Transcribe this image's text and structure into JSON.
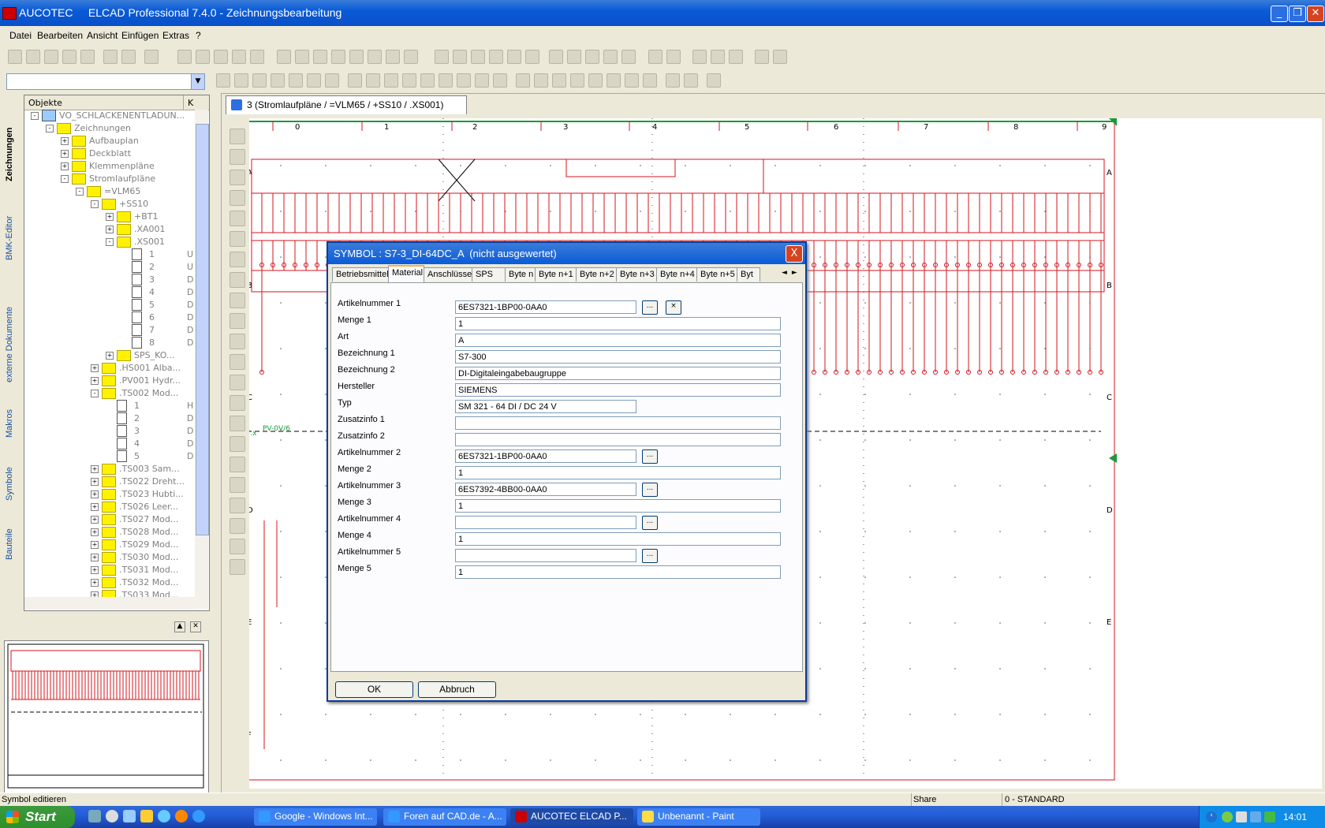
{
  "window": {
    "title": "AUCOTEC     ELCAD Professional 7.4.0 - Zeichnungsbearbeitung"
  },
  "menu": [
    "Datei",
    "Bearbeiten",
    "Ansicht",
    "Einfügen",
    "Extras",
    "?"
  ],
  "side_tabs": [
    "Zeichnungen",
    "BMK-Editor",
    "externe Dokumente",
    "Makros",
    "Symbole",
    "Bauteile"
  ],
  "object_panel": {
    "header_objects": "Objekte",
    "header_col2": "K",
    "tree": [
      {
        "label": "VO_SCHLACKENENTLADUN...",
        "level": 0,
        "expander": "-",
        "icon": "computer",
        "rv": ""
      },
      {
        "label": "Zeichnungen",
        "level": 1,
        "expander": "-",
        "icon": "folder",
        "rv": ""
      },
      {
        "label": "Aufbauplan",
        "level": 2,
        "expander": "+",
        "icon": "folder",
        "rv": ""
      },
      {
        "label": "Deckblatt",
        "level": 2,
        "expander": "+",
        "icon": "folder",
        "rv": ""
      },
      {
        "label": "Klemmenpläne",
        "level": 2,
        "expander": "+",
        "icon": "folder",
        "rv": ""
      },
      {
        "label": "Stromlaufpläne",
        "level": 2,
        "expander": "-",
        "icon": "folder",
        "rv": ""
      },
      {
        "label": "=VLM65",
        "level": 3,
        "expander": "-",
        "icon": "folder",
        "rv": ""
      },
      {
        "label": "+SS10",
        "level": 4,
        "expander": "-",
        "icon": "folder",
        "rv": ""
      },
      {
        "label": "+BT1",
        "level": 5,
        "expander": "+",
        "icon": "folder",
        "rv": ""
      },
      {
        "label": ".XA001",
        "level": 5,
        "expander": "+",
        "icon": "folder",
        "rv": ""
      },
      {
        "label": ".XS001",
        "level": 5,
        "expander": "-",
        "icon": "folder",
        "rv": ""
      },
      {
        "label": "1",
        "level": 6,
        "expander": "",
        "icon": "doc",
        "rv": "U"
      },
      {
        "label": "2",
        "level": 6,
        "expander": "",
        "icon": "doc",
        "rv": "U"
      },
      {
        "label": "3",
        "level": 6,
        "expander": "",
        "icon": "doc",
        "rv": "D"
      },
      {
        "label": "4",
        "level": 6,
        "expander": "",
        "icon": "doc",
        "rv": "D"
      },
      {
        "label": "5",
        "level": 6,
        "expander": "",
        "icon": "doc",
        "rv": "D"
      },
      {
        "label": "6",
        "level": 6,
        "expander": "",
        "icon": "doc",
        "rv": "D"
      },
      {
        "label": "7",
        "level": 6,
        "expander": "",
        "icon": "doc",
        "rv": "D"
      },
      {
        "label": "8",
        "level": 6,
        "expander": "",
        "icon": "doc",
        "rv": "D"
      },
      {
        "label": "SPS_KO...",
        "level": 5,
        "expander": "+",
        "icon": "folder",
        "rv": ""
      },
      {
        "label": ".HS001 Alba...",
        "level": 4,
        "expander": "+",
        "icon": "folder",
        "rv": ""
      },
      {
        "label": ".PV001 Hydr...",
        "level": 4,
        "expander": "+",
        "icon": "folder",
        "rv": ""
      },
      {
        "label": ".TS002 Mod...",
        "level": 4,
        "expander": "-",
        "icon": "folder",
        "rv": ""
      },
      {
        "label": "1",
        "level": 5,
        "expander": "",
        "icon": "doc",
        "rv": "H"
      },
      {
        "label": "2",
        "level": 5,
        "expander": "",
        "icon": "doc",
        "rv": "D"
      },
      {
        "label": "3",
        "level": 5,
        "expander": "",
        "icon": "doc",
        "rv": "D"
      },
      {
        "label": "4",
        "level": 5,
        "expander": "",
        "icon": "doc",
        "rv": "D"
      },
      {
        "label": "5",
        "level": 5,
        "expander": "",
        "icon": "doc",
        "rv": "D"
      },
      {
        "label": ".TS003 Sam...",
        "level": 4,
        "expander": "+",
        "icon": "folder",
        "rv": ""
      },
      {
        "label": ".TS022 Dreht...",
        "level": 4,
        "expander": "+",
        "icon": "folder",
        "rv": ""
      },
      {
        "label": ".TS023 Hubti...",
        "level": 4,
        "expander": "+",
        "icon": "folder",
        "rv": ""
      },
      {
        "label": ".TS026 Leer...",
        "level": 4,
        "expander": "+",
        "icon": "folder",
        "rv": ""
      },
      {
        "label": ".TS027 Mod...",
        "level": 4,
        "expander": "+",
        "icon": "folder",
        "rv": ""
      },
      {
        "label": ".TS028 Mod...",
        "level": 4,
        "expander": "+",
        "icon": "folder",
        "rv": ""
      },
      {
        "label": ".TS029 Mod...",
        "level": 4,
        "expander": "+",
        "icon": "folder",
        "rv": ""
      },
      {
        "label": ".TS030 Mod...",
        "level": 4,
        "expander": "+",
        "icon": "folder",
        "rv": ""
      },
      {
        "label": ".TS031 Mod...",
        "level": 4,
        "expander": "+",
        "icon": "folder",
        "rv": ""
      },
      {
        "label": ".TS032 Mod...",
        "level": 4,
        "expander": "+",
        "icon": "folder",
        "rv": ""
      },
      {
        "label": ".TS033 Mod...",
        "level": 4,
        "expander": "+",
        "icon": "folder",
        "rv": ""
      }
    ]
  },
  "document": {
    "tab_label": "3 (Stromlaufpläne / =VLM65 / +SS10 / .XS001)",
    "columns": [
      "0",
      "1",
      "2",
      "3",
      "4",
      "5",
      "6",
      "7",
      "8",
      "9"
    ],
    "rows": [
      "A",
      "B",
      "C",
      "D",
      "E",
      "F"
    ],
    "annotation_left": "S1/7.x",
    "annotation_pv": "PV-0V/6"
  },
  "dialog": {
    "title": "SYMBOL : S7-3_DI-64DC_A  (nicht ausgewertet)",
    "close": "X",
    "tabs": [
      "Betriebsmittel",
      "Material",
      "Anschlüsse",
      "SPS",
      "Byte n",
      "Byte n+1",
      "Byte n+2",
      "Byte n+3",
      "Byte n+4",
      "Byte n+5",
      "Byt"
    ],
    "active_tab": "Material",
    "fields": [
      {
        "label": "Artikelnummer 1",
        "value": "6ES7321-1BP00-0AA0",
        "browse": true,
        "clear": true
      },
      {
        "label": "Menge 1",
        "value": "1"
      },
      {
        "label": "Art",
        "value": "A"
      },
      {
        "label": "Bezeichnung 1",
        "value": "S7-300"
      },
      {
        "label": "Bezeichnung 2",
        "value": "DI-Digitaleingabebaugruppe"
      },
      {
        "label": "Hersteller",
        "value": "SIEMENS"
      },
      {
        "label": "Typ",
        "value": "SM 321 - 64 DI / DC 24 V",
        "short": true
      },
      {
        "label": "Zusatzinfo 1",
        "value": ""
      },
      {
        "label": "Zusatzinfo 2",
        "value": ""
      },
      {
        "label": "Artikelnummer 2",
        "value": "6ES7321-1BP00-0AA0",
        "browse": true
      },
      {
        "label": "Menge 2",
        "value": "1"
      },
      {
        "label": "Artikelnummer 3",
        "value": "6ES7392-4BB00-0AA0",
        "browse": true
      },
      {
        "label": "Menge 3",
        "value": "1"
      },
      {
        "label": "Artikelnummer 4",
        "value": "",
        "browse": true
      },
      {
        "label": "Menge 4",
        "value": "1"
      },
      {
        "label": "Artikelnummer 5",
        "value": "",
        "browse": true
      },
      {
        "label": "Menge 5",
        "value": "1"
      }
    ],
    "browse_label": "...",
    "clear_label": "×",
    "ok": "OK",
    "cancel": "Abbruch"
  },
  "status": {
    "left": "Symbol editieren",
    "share": "Share",
    "layer": "0 - STANDARD"
  },
  "taskbar": {
    "start": "Start",
    "tasks": [
      {
        "label": "Google - Windows Int...",
        "active": false
      },
      {
        "label": "Foren auf CAD.de - A...",
        "active": false
      },
      {
        "label": "AUCOTEC     ELCAD P...",
        "active": true
      },
      {
        "label": "Unbenannt - Paint",
        "active": false
      }
    ],
    "clock": "14:01"
  },
  "colors": {
    "drawing_red": "#d4141e",
    "drawing_green": "#1a9a3a",
    "xp_blue": "#0a5bd8"
  }
}
